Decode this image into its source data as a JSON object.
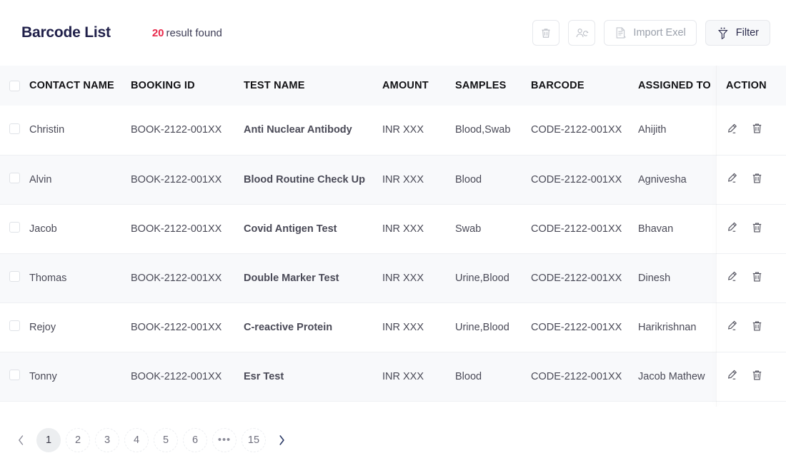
{
  "header": {
    "title": "Barcode List",
    "result_count": "20",
    "result_label": "result found"
  },
  "toolbar": {
    "delete_label": "",
    "assign_label": "",
    "import_label": "Import Exel",
    "filter_label": "Filter",
    "icons": {
      "delete": "trash-icon",
      "assign": "assign-user-icon",
      "import": "document-icon",
      "filter": "funnel-icon"
    }
  },
  "table": {
    "columns": [
      "CONTACT NAME",
      "BOOKING ID",
      "TEST NAME",
      "AMOUNT",
      "SAMPLES",
      "BARCODE",
      "ASSIGNED TO",
      "ACTION"
    ],
    "rows": [
      {
        "contact_name": "Christin",
        "booking_id": "BOOK-2122-001XX",
        "test_name": "Anti Nuclear Antibody",
        "amount": "INR XXX",
        "samples": "Blood,Swab",
        "barcode": "CODE-2122-001XX",
        "assigned_to": "Ahijith"
      },
      {
        "contact_name": "Alvin",
        "booking_id": "BOOK-2122-001XX",
        "test_name": "Blood Routine Check Up",
        "amount": "INR XXX",
        "samples": "Blood",
        "barcode": "CODE-2122-001XX",
        "assigned_to": "Agnivesha"
      },
      {
        "contact_name": "Jacob",
        "booking_id": "BOOK-2122-001XX",
        "test_name": "Covid Antigen Test",
        "amount": "INR XXX",
        "samples": "Swab",
        "barcode": "CODE-2122-001XX",
        "assigned_to": "Bhavan"
      },
      {
        "contact_name": "Thomas",
        "booking_id": "BOOK-2122-001XX",
        "test_name": "Double Marker Test",
        "amount": "INR XXX",
        "samples": "Urine,Blood",
        "barcode": "CODE-2122-001XX",
        "assigned_to": "Dinesh"
      },
      {
        "contact_name": "Rejoy",
        "booking_id": "BOOK-2122-001XX",
        "test_name": "C-reactive Protein",
        "amount": "INR XXX",
        "samples": "Urine,Blood",
        "barcode": "CODE-2122-001XX",
        "assigned_to": "Harikrishnan"
      },
      {
        "contact_name": "Tonny",
        "booking_id": "BOOK-2122-001XX",
        "test_name": "Esr Test",
        "amount": "INR XXX",
        "samples": "Blood",
        "barcode": "CODE-2122-001XX",
        "assigned_to": "Jacob Mathew"
      }
    ],
    "row_actions": {
      "edit": "edit-pencil-icon",
      "delete": "trash-icon"
    }
  },
  "pagination": {
    "prev": "‹",
    "next": "›",
    "pages": [
      "1",
      "2",
      "3",
      "4",
      "5",
      "6",
      "•••",
      "15"
    ],
    "active_page": "1"
  },
  "colors": {
    "accent_red": "#e8284a",
    "title_navy": "#20204a",
    "header_bg": "#f8f9fb",
    "row_alt_bg": "#f8f9fb"
  }
}
